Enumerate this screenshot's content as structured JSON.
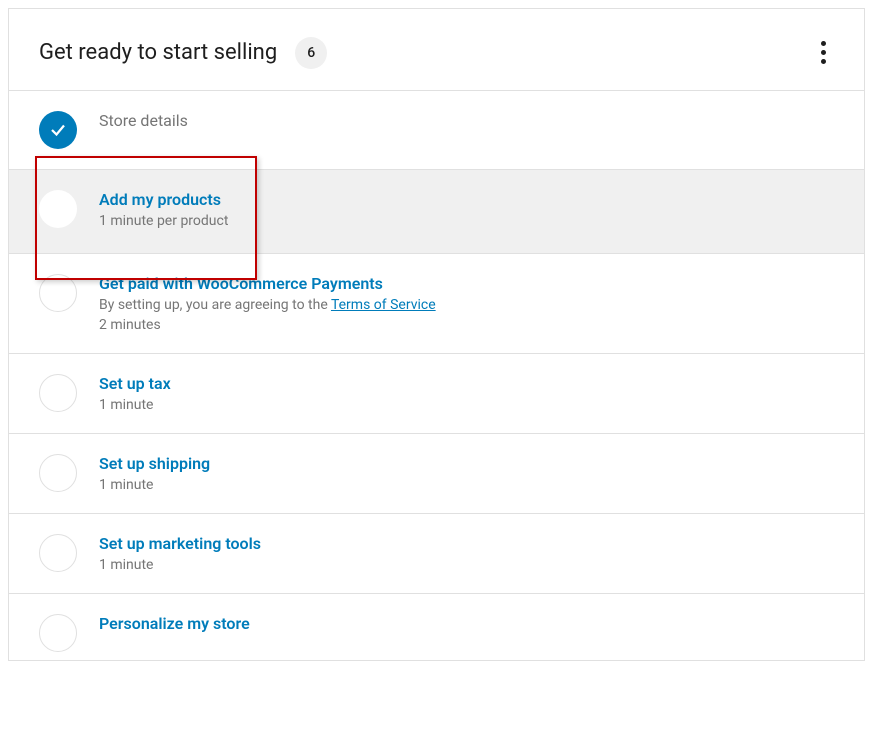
{
  "header": {
    "title": "Get ready to start selling",
    "badge_count": "6"
  },
  "tasks": [
    {
      "status": "completed",
      "title": "Store details"
    },
    {
      "status": "pending",
      "highlighted": true,
      "title": "Add my products",
      "subtitle": "1 minute per product"
    },
    {
      "status": "pending",
      "title": "Get paid with WooCommerce Payments",
      "subtitle_prefix": "By setting up, you are agreeing to the ",
      "subtitle_link": "Terms of Service",
      "time": "2 minutes"
    },
    {
      "status": "pending",
      "title": "Set up tax",
      "time": "1 minute"
    },
    {
      "status": "pending",
      "title": "Set up shipping",
      "time": "1 minute"
    },
    {
      "status": "pending",
      "title": "Set up marketing tools",
      "time": "1 minute"
    },
    {
      "status": "pending",
      "title": "Personalize my store"
    }
  ]
}
